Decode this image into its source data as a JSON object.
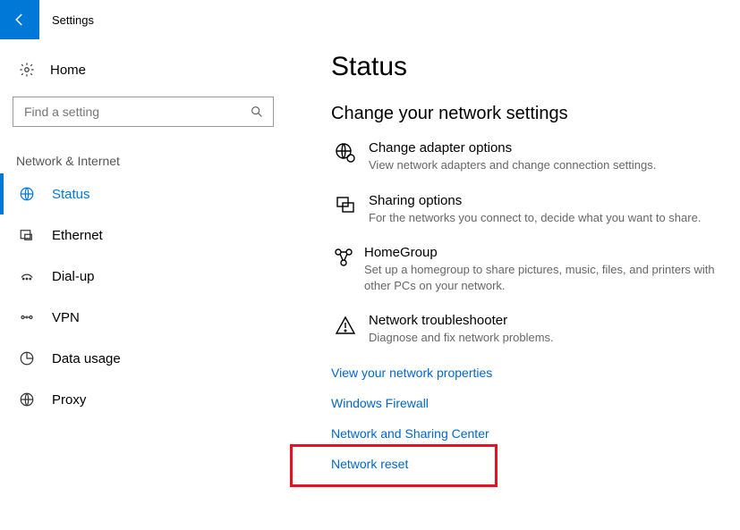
{
  "app": {
    "title": "Settings"
  },
  "sidebar": {
    "home": "Home",
    "search_placeholder": "Find a setting",
    "section": "Network & Internet",
    "items": [
      {
        "label": "Status",
        "active": true
      },
      {
        "label": "Ethernet",
        "active": false
      },
      {
        "label": "Dial-up",
        "active": false
      },
      {
        "label": "VPN",
        "active": false
      },
      {
        "label": "Data usage",
        "active": false
      },
      {
        "label": "Proxy",
        "active": false
      }
    ]
  },
  "main": {
    "title": "Status",
    "heading": "Change your network settings",
    "options": [
      {
        "title": "Change adapter options",
        "desc": "View network adapters and change connection settings."
      },
      {
        "title": "Sharing options",
        "desc": "For the networks you connect to, decide what you want to share."
      },
      {
        "title": "HomeGroup",
        "desc": "Set up a homegroup to share pictures, music, files, and printers with other PCs on your network."
      },
      {
        "title": "Network troubleshooter",
        "desc": "Diagnose and fix network problems."
      }
    ],
    "links": [
      "View your network properties",
      "Windows Firewall",
      "Network and Sharing Center",
      "Network reset"
    ]
  }
}
